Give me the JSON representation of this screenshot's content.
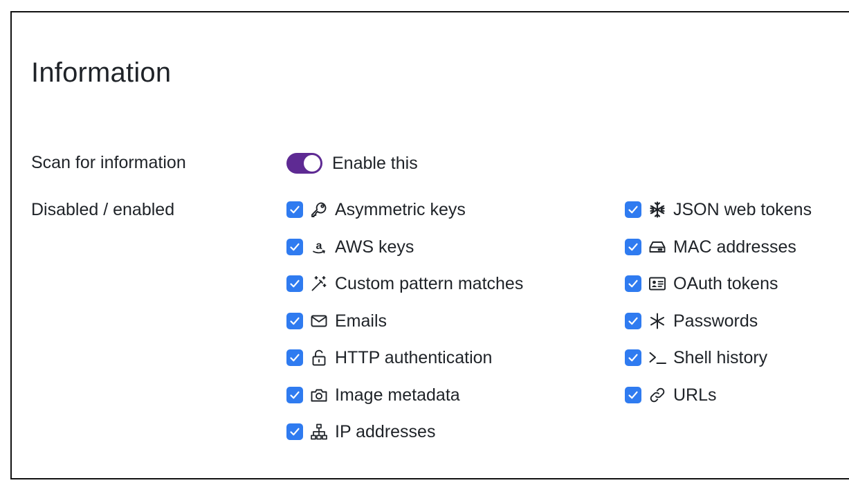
{
  "section": {
    "title": "Information"
  },
  "scan": {
    "label": "Scan for information",
    "toggle_label": "Enable this",
    "toggle_on": true,
    "toggle_color": "#5e2a93"
  },
  "types": {
    "label": "Disabled / enabled",
    "checkbox_color": "#2f7bf0",
    "left": [
      {
        "label": "Asymmetric keys",
        "icon": "key-icon",
        "checked": true
      },
      {
        "label": "AWS keys",
        "icon": "amazon-icon",
        "checked": true
      },
      {
        "label": "Custom pattern matches",
        "icon": "magic-wand-icon",
        "checked": true
      },
      {
        "label": "Emails",
        "icon": "envelope-icon",
        "checked": true
      },
      {
        "label": "HTTP authentication",
        "icon": "unlock-icon",
        "checked": true
      },
      {
        "label": "Image metadata",
        "icon": "camera-icon",
        "checked": true
      },
      {
        "label": "IP addresses",
        "icon": "network-icon",
        "checked": true
      }
    ],
    "right": [
      {
        "label": "JSON web tokens",
        "icon": "snowflake-icon",
        "checked": true
      },
      {
        "label": "MAC addresses",
        "icon": "hard-drive-icon",
        "checked": true
      },
      {
        "label": "OAuth tokens",
        "icon": "id-card-icon",
        "checked": true
      },
      {
        "label": "Passwords",
        "icon": "asterisk-icon",
        "checked": true
      },
      {
        "label": "Shell history",
        "icon": "terminal-icon",
        "checked": true
      },
      {
        "label": "URLs",
        "icon": "link-icon",
        "checked": true
      }
    ]
  }
}
